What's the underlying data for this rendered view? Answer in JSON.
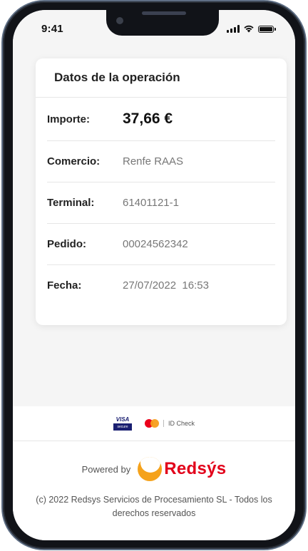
{
  "status_bar": {
    "time": "9:41"
  },
  "card": {
    "title": "Datos de la operación",
    "rows": [
      {
        "label": "Importe:",
        "value": "37,66 €"
      },
      {
        "label": "Comercio:",
        "value": "Renfe RAAS"
      },
      {
        "label": "Terminal:",
        "value": "61401121-1"
      },
      {
        "label": "Pedido:",
        "value": "00024562342"
      },
      {
        "label": "Fecha:",
        "value": "27/07/2022  16:53"
      }
    ]
  },
  "brands": {
    "visa_label": "VISA",
    "visa_sub": "secure",
    "id_check": "ID Check"
  },
  "footer": {
    "powered_by": "Powered by",
    "logo_text": "Redsýs",
    "copyright": "(c) 2022 Redsys Servicios de Procesamiento SL - Todos los derechos reservados"
  },
  "colors": {
    "brand_red": "#e2001a",
    "brand_orange": "#f5a21b",
    "visa_blue": "#1a1f71"
  }
}
